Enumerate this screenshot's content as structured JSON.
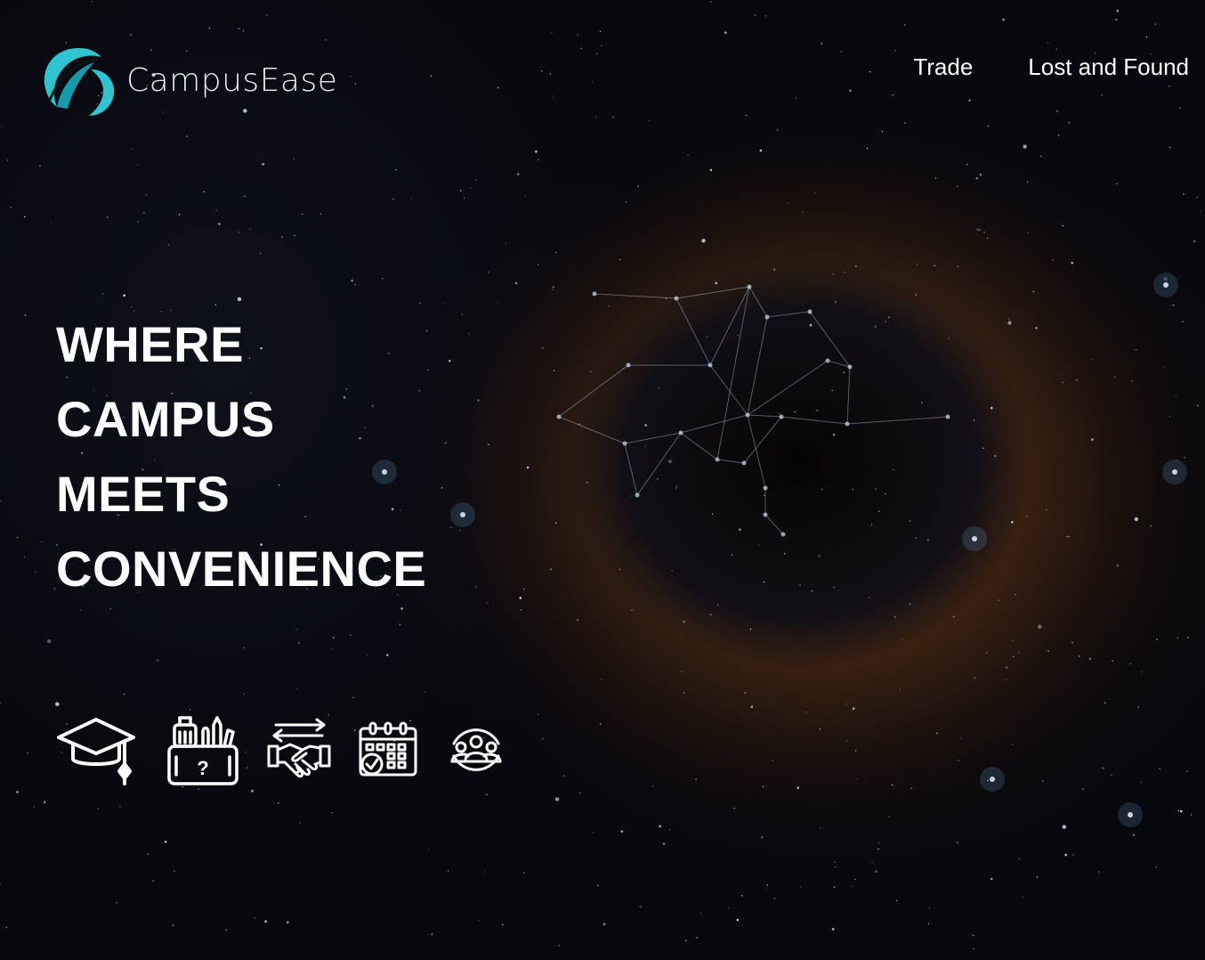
{
  "header": {
    "logo_text": "CampusEase",
    "brand_color": "#2fc4d0",
    "nav": [
      {
        "label": "Trade"
      },
      {
        "label": "Lost and Found"
      }
    ]
  },
  "hero": {
    "lines": [
      "WHERE",
      "CAMPUS",
      "MEETS",
      "CONVENIENCE"
    ]
  },
  "features": [
    {
      "icon": "graduation-cap-icon"
    },
    {
      "icon": "lost-and-found-box-icon"
    },
    {
      "icon": "trade-handshake-icon"
    },
    {
      "icon": "calendar-icon"
    },
    {
      "icon": "community-group-icon"
    }
  ]
}
